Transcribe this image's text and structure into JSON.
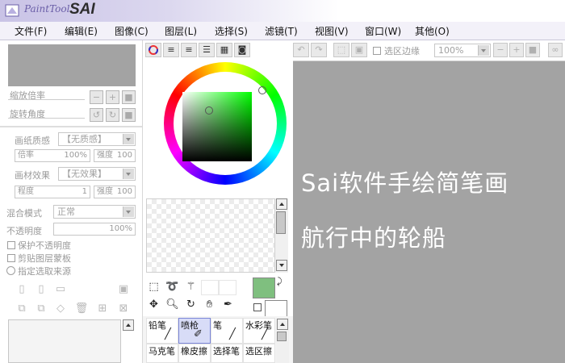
{
  "app": {
    "logo_text": "PaintTool",
    "logo_brand": "SAI"
  },
  "menu": [
    {
      "label": "文件(F)"
    },
    {
      "label": "编辑(E)"
    },
    {
      "label": "图像(C)"
    },
    {
      "label": "图层(L)"
    },
    {
      "label": "选择(S)"
    },
    {
      "label": "滤镜(T)"
    },
    {
      "label": "视图(V)"
    },
    {
      "label": "窗口(W)"
    },
    {
      "label": "其他(O)"
    }
  ],
  "navigator": {
    "zoom_label": "缩放倍率",
    "rotate_label": "旋转角度"
  },
  "layer_panel": {
    "paper_texture_label": "画纸质感",
    "paper_texture_value": "【无质感】",
    "scale_label": "倍率",
    "scale_value": "100%",
    "strength_label": "强度",
    "strength_value": "100",
    "material_effect_label": "画材效果",
    "material_effect_value": "【无效果】",
    "degree_label": "程度",
    "degree_value": "1",
    "strength2_label": "强度",
    "strength2_value": "100",
    "blend_mode_label": "混合模式",
    "blend_mode_value": "正常",
    "opacity_label": "不透明度",
    "opacity_value": "100%",
    "preserve_opacity": "保护不透明度",
    "clipping_group": "剪贴图层蒙板",
    "selection_source": "指定选取来源"
  },
  "canvas_toolbar": {
    "selection_edge": "选区边缘",
    "zoom_value": "100%"
  },
  "colors": {
    "primary": "#7fbf7f",
    "secondary": "#ffffff",
    "canvas_bg": "#a3a3a3"
  },
  "brushes": {
    "row1": [
      "铅笔",
      "喷枪",
      "笔",
      "水彩笔"
    ],
    "row2": [
      "马克笔",
      "橡皮擦",
      "选择笔",
      "选区擦"
    ],
    "selected": "喷枪"
  },
  "canvas_text": {
    "line1": "Sai软件手绘简笔画",
    "line2": "航行中的轮船"
  }
}
